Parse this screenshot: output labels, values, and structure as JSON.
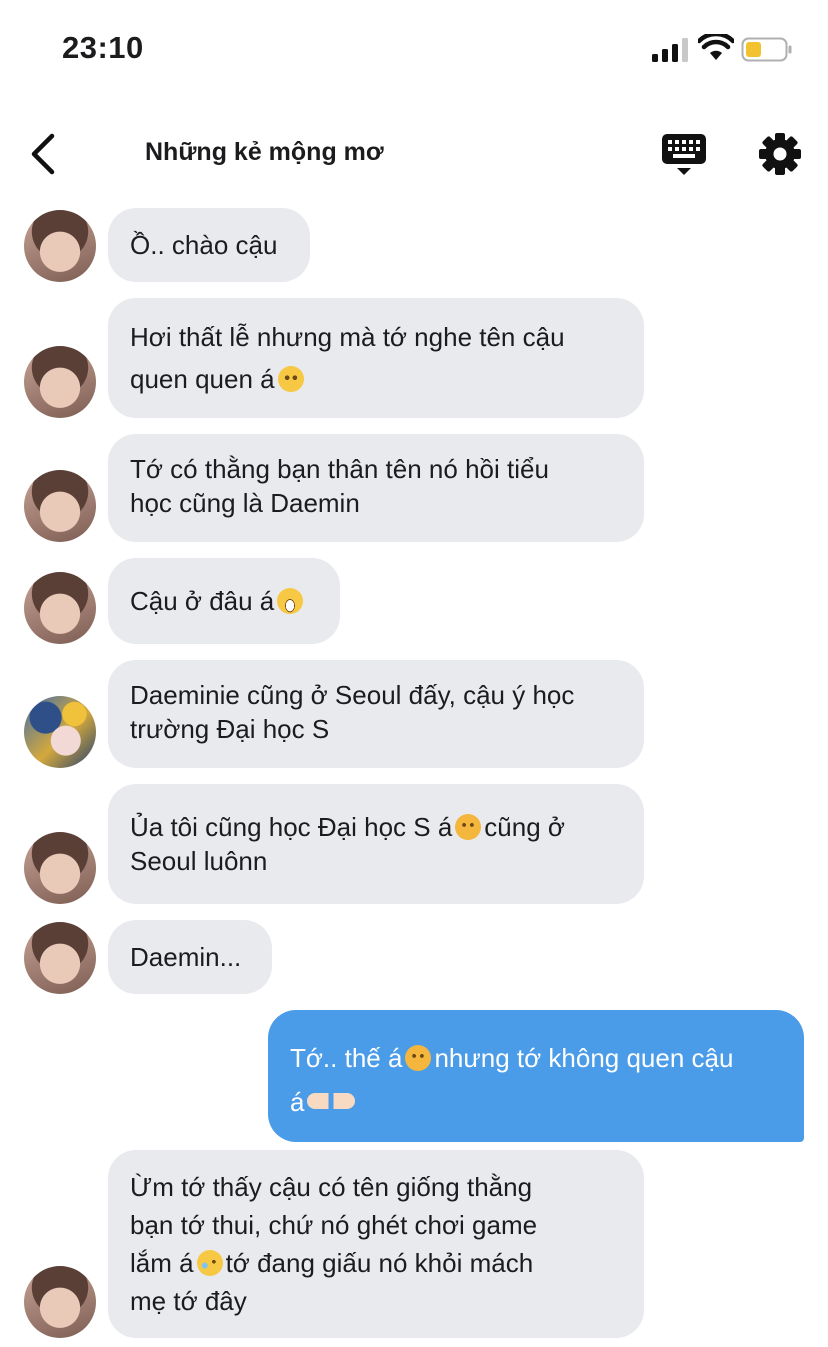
{
  "status": {
    "time": "23:10"
  },
  "nav": {
    "title": "Những kẻ mộng mơ"
  },
  "messages": [
    {
      "lines": [
        "Ồ.. chào cậu"
      ]
    },
    {
      "lines": [
        "Hơi thất lễ nhưng mà tớ nghe tên cậu",
        "quen quen á"
      ],
      "emoji": "pleading-face"
    },
    {
      "lines": [
        "Tớ có thằng bạn thân tên nó hồi tiểu",
        "học cũng là Daemin"
      ]
    },
    {
      "lines": [
        "Cậu ở đâu á"
      ],
      "emoji": "grinning-face"
    },
    {
      "lines": [
        "Daeminie cũng ở Seoul đấy, cậu ý học",
        "trường Đại học S"
      ]
    },
    {
      "lines": [
        "Ủa tôi cũng học Đại học S á",
        "cũng ở",
        "Seoul luônn"
      ],
      "emoji": "frowning-face"
    },
    {
      "lines": [
        "Daemin..."
      ]
    },
    {
      "lines": [
        "Tớ.. thế á",
        "nhưng tớ không quen cậu",
        "á"
      ],
      "emoji": [
        "worried-face",
        "pointing-hands"
      ]
    },
    {
      "lines": [
        "Ừm tớ thấy cậu có tên giống thằng",
        "bạn tớ thui, chứ nó ghét chơi game",
        "lắm á",
        "tớ đang giấu nó khỏi mách",
        "mẹ tớ đây"
      ],
      "emoji": "crying-face"
    }
  ]
}
